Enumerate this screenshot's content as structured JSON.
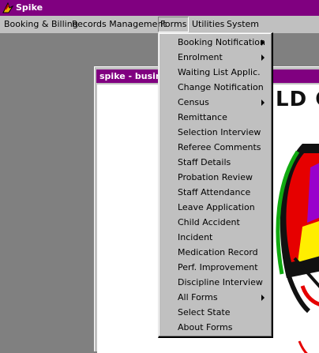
{
  "window": {
    "title": "Spike"
  },
  "menubar": {
    "items": [
      {
        "label": "Booking & Billing"
      },
      {
        "label": "Records Management"
      },
      {
        "label": "Forms"
      },
      {
        "label": "Utilities"
      },
      {
        "label": "System"
      }
    ]
  },
  "child_window": {
    "title": "spike - busine",
    "banner": "LD CA"
  },
  "forms_menu": {
    "items": [
      {
        "label": "Booking Notification",
        "submenu": true
      },
      {
        "label": "Enrolment",
        "submenu": true
      },
      {
        "label": "Waiting List Applic."
      },
      {
        "label": "Change Notification"
      },
      {
        "label": "Census",
        "submenu": true
      },
      {
        "label": "Remittance"
      },
      {
        "label": "Selection Interview"
      },
      {
        "label": "Referee Comments"
      },
      {
        "label": "Staff Details"
      },
      {
        "label": "Probation Review"
      },
      {
        "label": "Staff Attendance"
      },
      {
        "label": "Leave Application"
      },
      {
        "label": "Child Accident"
      },
      {
        "label": "Incident"
      },
      {
        "label": "Medication Record"
      },
      {
        "label": "Perf. Improvement"
      },
      {
        "label": "Discipline Interview"
      },
      {
        "label": "All Forms",
        "submenu": true
      },
      {
        "label": "Select State"
      },
      {
        "label": "About Forms"
      }
    ]
  },
  "colors": {
    "titlebar": "#800080",
    "face": "#c0c0c0",
    "desktop": "#808080"
  }
}
